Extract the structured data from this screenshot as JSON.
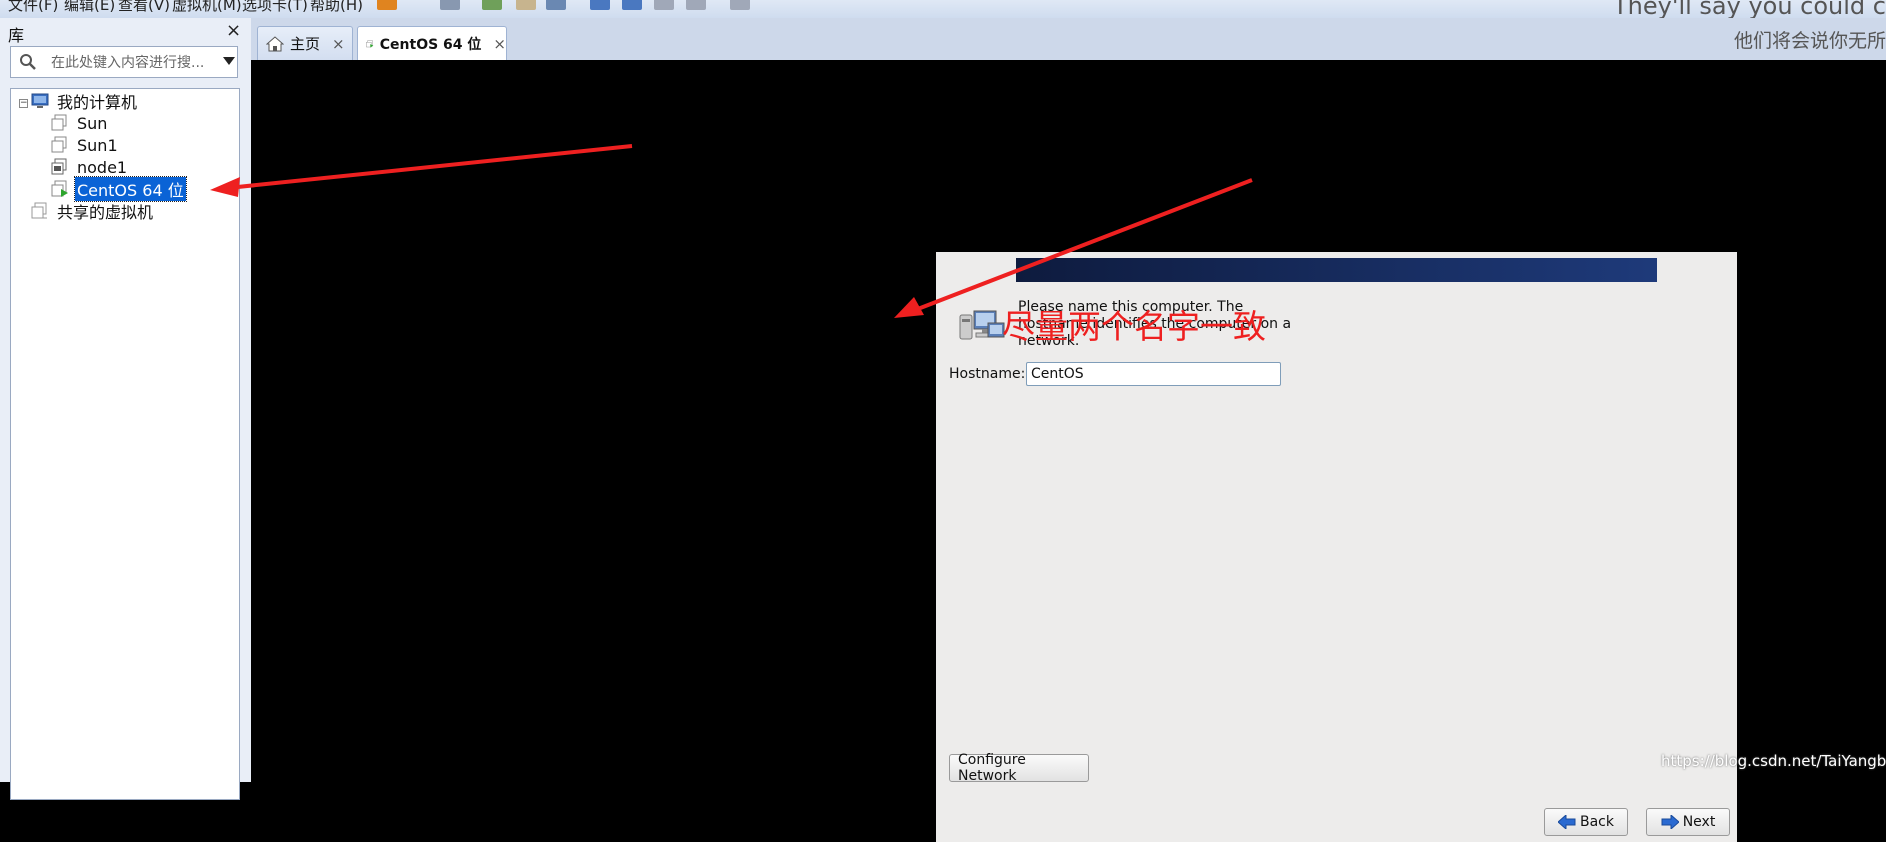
{
  "library": {
    "title": "库",
    "close": "×",
    "search_placeholder": "在此处键入内容进行搜..."
  },
  "tree": [
    {
      "label": "我的计算机",
      "kind": "computer"
    },
    {
      "label": "Sun",
      "kind": "vm"
    },
    {
      "label": "Sun1",
      "kind": "vm"
    },
    {
      "label": "node1",
      "kind": "vm-team"
    },
    {
      "label": "CentOS 64 位",
      "kind": "vm-running",
      "selected": true
    },
    {
      "label": "共享的虚拟机",
      "kind": "shared"
    }
  ],
  "tabs": [
    {
      "label": "主页",
      "icon": "home-icon",
      "close": "×"
    },
    {
      "label": "CentOS 64 位",
      "icon": "vm-running-icon",
      "close": "×",
      "active": true
    }
  ],
  "installer": {
    "description": "Please name this computer.  The hostname identifies the computer on a network.",
    "hostname_label": "Hostname:",
    "hostname_value": "CentOS",
    "configure_network": "Configure Network",
    "back": "Back",
    "next": "Next"
  },
  "overlay": {
    "annotation": "尽量两个名字一致",
    "song_en": "They'll say you could c",
    "song_zh": "他们将会说你无所",
    "watermark": "https://blog.csdn.net/TaiYangb"
  },
  "colors": {
    "selection": "#0a63d6",
    "annotation": "#ee2020",
    "banner": "#1e3a7a"
  }
}
